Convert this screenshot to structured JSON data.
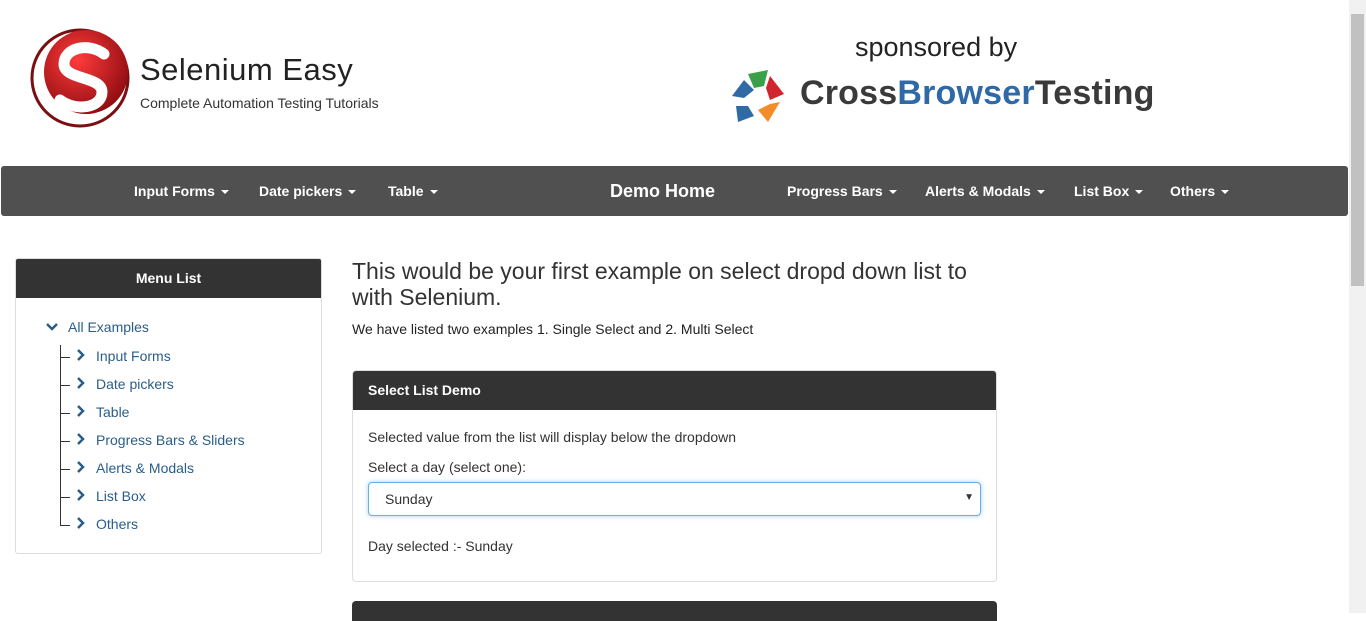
{
  "header": {
    "brand_title": "Selenium Easy",
    "brand_subtitle": "Complete Automation Testing Tutorials",
    "sponsored_text": "sponsored by",
    "sponsor_part1": "CrossBrowser",
    "sponsor_part2": "Testing"
  },
  "navbar": {
    "items": [
      {
        "label": "Input Forms"
      },
      {
        "label": "Date pickers"
      },
      {
        "label": "Table"
      },
      {
        "label": "Demo Home"
      },
      {
        "label": "Progress Bars"
      },
      {
        "label": "Alerts & Modals"
      },
      {
        "label": "List Box"
      },
      {
        "label": "Others"
      }
    ]
  },
  "sidebar": {
    "heading": "Menu List",
    "root": "All Examples",
    "items": [
      {
        "label": "Input Forms"
      },
      {
        "label": "Date pickers"
      },
      {
        "label": "Table"
      },
      {
        "label": "Progress Bars & Sliders"
      },
      {
        "label": "Alerts & Modals"
      },
      {
        "label": "List Box"
      },
      {
        "label": "Others"
      }
    ]
  },
  "main": {
    "title": "This would be your first example on select dropd down list to with Selenium.",
    "description": "We have listed two examples 1. Single Select and 2. Multi Select",
    "panel": {
      "heading": "Select List Demo",
      "info": "Selected value from the list will display below the dropdown",
      "label": "Select a day (select one):",
      "selected_value": "Sunday",
      "result": "Day selected :- Sunday"
    }
  },
  "colors": {
    "navbar_bg": "#505050",
    "panel_head_bg": "#333333",
    "link_color": "#2a5d8a",
    "brand_red": "#c4161c",
    "sponsor_blue": "#2f6aa6"
  }
}
